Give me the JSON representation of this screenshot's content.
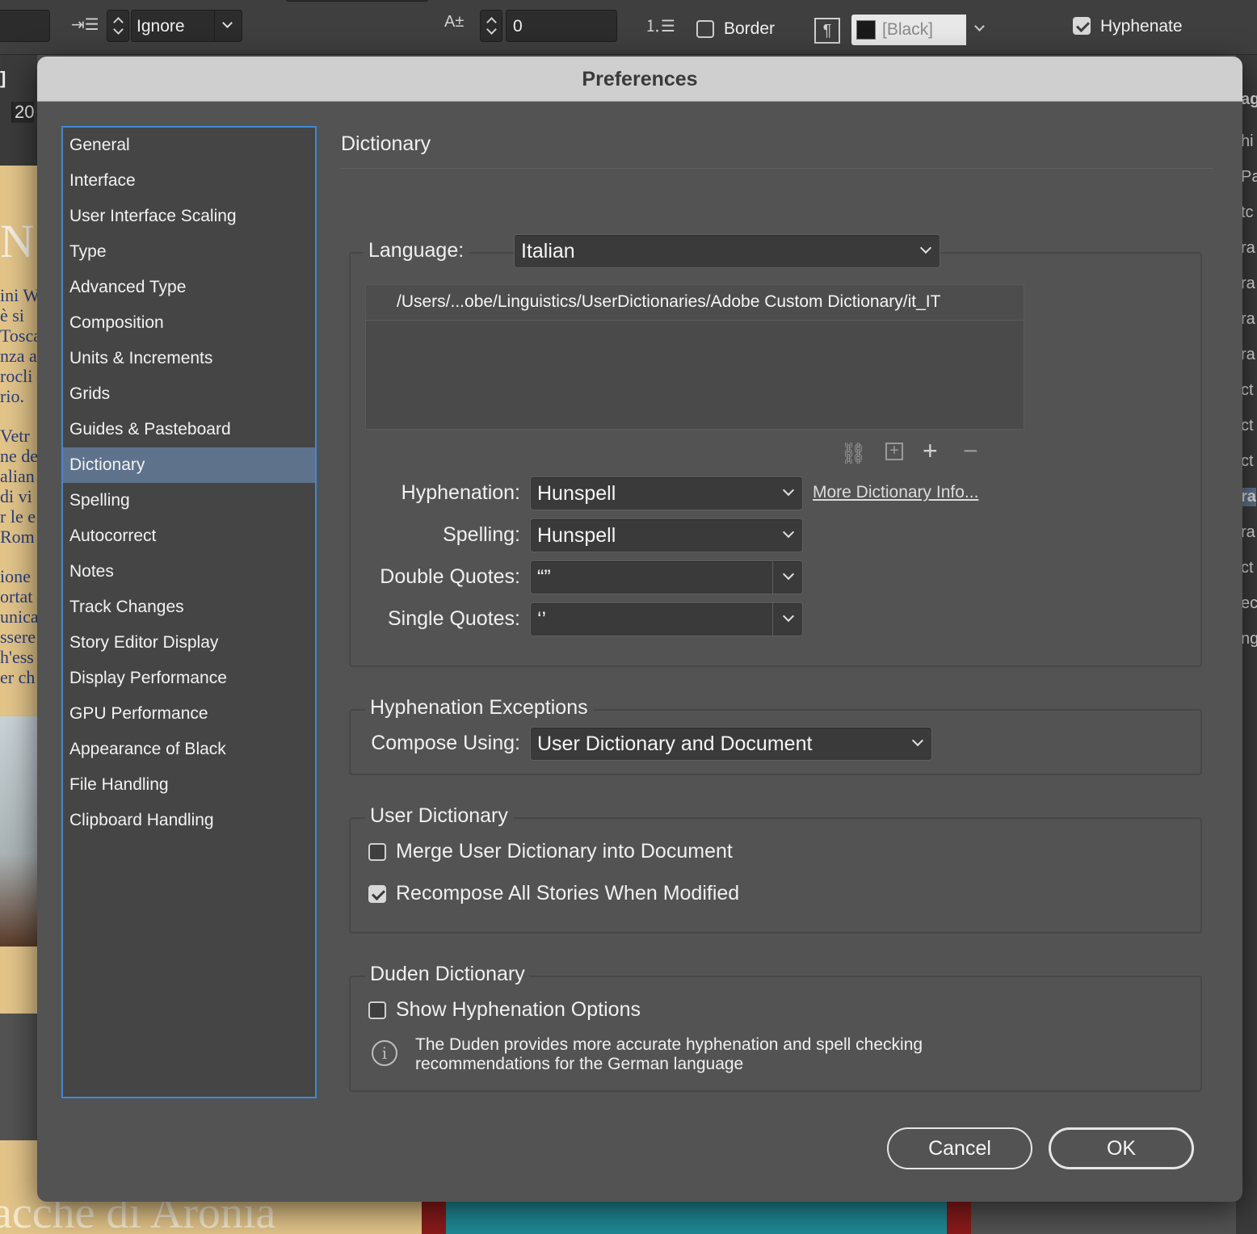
{
  "toolbar": {
    "ignore_value": "Ignore",
    "spacing_value": "0",
    "border_label": "Border",
    "color_value": "[Black]",
    "hyphenate_label": "Hyphenate",
    "hyphenate_checked": true,
    "border_checked": false,
    "side_label": "]",
    "side_number": "20"
  },
  "background_doc": {
    "big_letter": "N",
    "text_lines_1": [
      "ini W",
      " è si",
      "Tosca",
      "nza a",
      "rocli",
      "rio."
    ],
    "text_lines_2": [
      " Vetr",
      "ne de",
      "alian",
      "di vi",
      "r le e",
      "Rom"
    ],
    "text_lines_3": [
      "ione",
      "ortat",
      "unica",
      "ssere",
      "h'ess",
      "er ch"
    ],
    "bottom_title": "acche di Aronia"
  },
  "right_panel_items": [
    "ag",
    "hi",
    "Pa",
    "tc",
    "ra",
    "ra",
    "ra",
    "ra",
    "ct",
    "ct",
    "ct",
    "ra",
    "ra",
    "ct",
    "ec",
    "ng"
  ],
  "dialog": {
    "title": "Preferences",
    "sidebar": {
      "items": [
        "General",
        "Interface",
        "User Interface Scaling",
        "Type",
        "Advanced Type",
        "Composition",
        "Units & Increments",
        "Grids",
        "Guides & Pasteboard",
        "Dictionary",
        "Spelling",
        "Autocorrect",
        "Notes",
        "Track Changes",
        "Story Editor Display",
        "Display Performance",
        "GPU Performance",
        "Appearance of Black",
        "File Handling",
        "Clipboard Handling"
      ],
      "selected": "Dictionary"
    },
    "page_heading": "Dictionary",
    "language": {
      "label": "Language:",
      "value": "Italian",
      "paths": [
        "/Users/...obe/Linguistics/UserDictionaries/Adobe Custom Dictionary/it_IT"
      ]
    },
    "icons": {
      "relink": "link-icon",
      "new": "new-dictionary-icon",
      "add": "plus-icon",
      "remove": "minus-icon"
    },
    "hyphenation": {
      "label": "Hyphenation:",
      "value": "Hunspell"
    },
    "more_info_link": "More Dictionary Info...",
    "spelling": {
      "label": "Spelling:",
      "value": "Hunspell"
    },
    "double_quotes": {
      "label": "Double Quotes:",
      "value": "“”"
    },
    "single_quotes": {
      "label": "Single Quotes:",
      "value": "‘’"
    },
    "hyphenation_exceptions": {
      "legend": "Hyphenation Exceptions",
      "compose_label": "Compose Using:",
      "compose_value": "User Dictionary and Document"
    },
    "user_dictionary": {
      "legend": "User Dictionary",
      "merge_label": "Merge User Dictionary into Document",
      "merge_checked": false,
      "recompose_label": "Recompose All Stories When Modified",
      "recompose_checked": true
    },
    "duden_dictionary": {
      "legend": "Duden Dictionary",
      "show_options_label": "Show Hyphenation Options",
      "show_options_checked": false,
      "info_text": "The Duden provides more accurate hyphenation and spell checking recommendations for the German language"
    },
    "buttons": {
      "cancel": "Cancel",
      "ok": "OK"
    }
  }
}
